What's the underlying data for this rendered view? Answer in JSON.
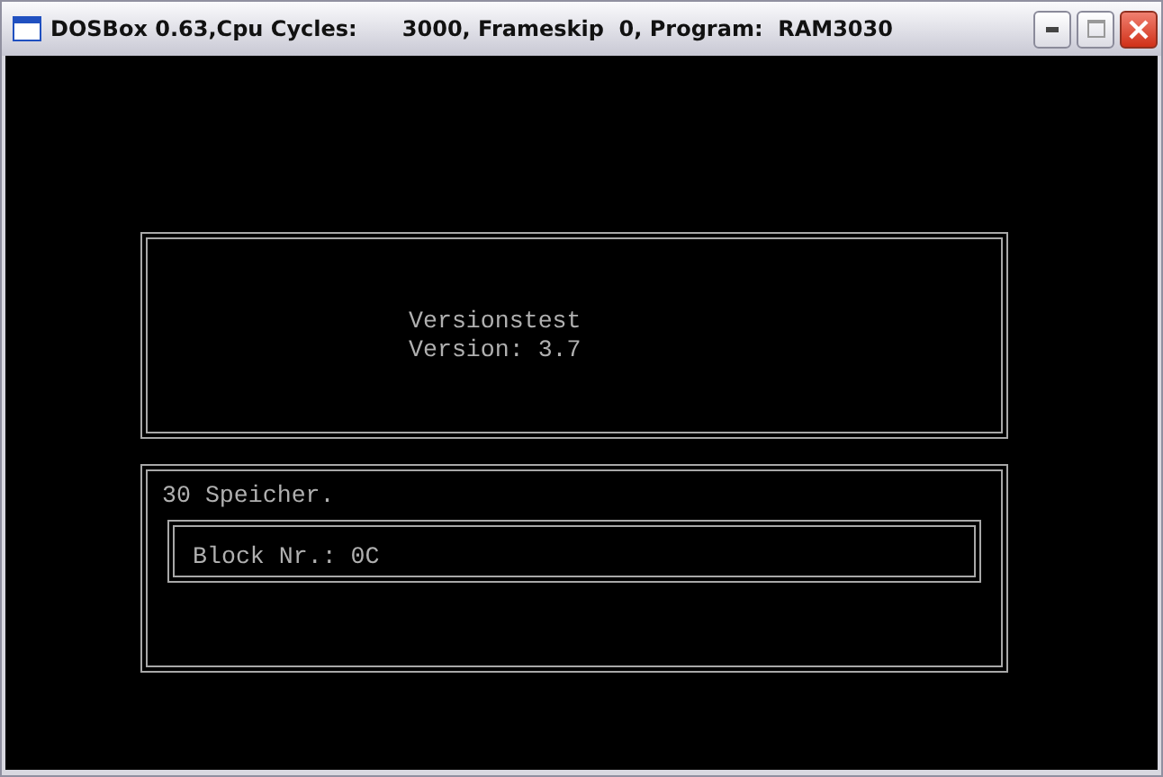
{
  "window": {
    "title": "DOSBox 0.63,Cpu Cycles:      3000, Frameskip  0, Program:  RAM3030"
  },
  "header_box": {
    "lines": [
      "Versionstest",
      "Version: 3.7"
    ]
  },
  "status_box": {
    "message": "30 Speicher.",
    "block": "Block Nr.: 0C"
  }
}
